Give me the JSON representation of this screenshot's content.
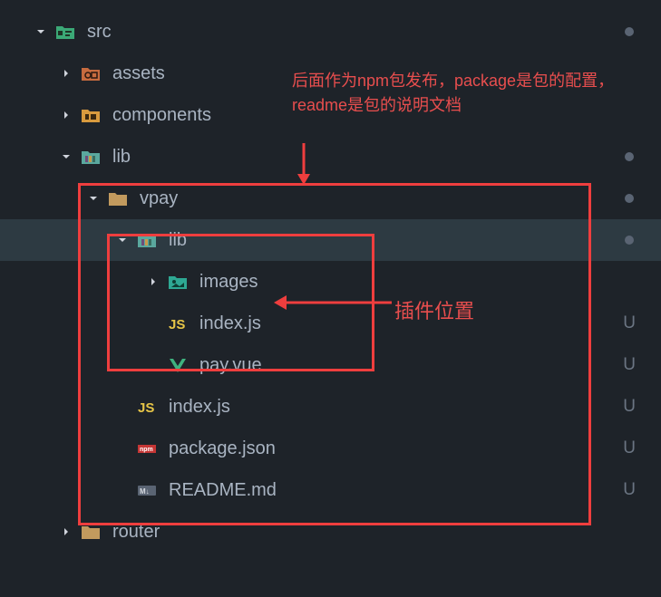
{
  "tree": {
    "src": "src",
    "assets": "assets",
    "components": "components",
    "lib1": "lib",
    "vpay": "vpay",
    "lib2": "lib",
    "images": "images",
    "indexjs1": "index.js",
    "payvue": "pay.vue",
    "indexjs2": "index.js",
    "packagejson": "package.json",
    "readme": "README.md",
    "router": "router"
  },
  "status": {
    "u": "U"
  },
  "annotations": {
    "publish_note": "后面作为npm包发布，package是包的配置，readme是包的说明文档",
    "plugin_location": "插件位置"
  }
}
